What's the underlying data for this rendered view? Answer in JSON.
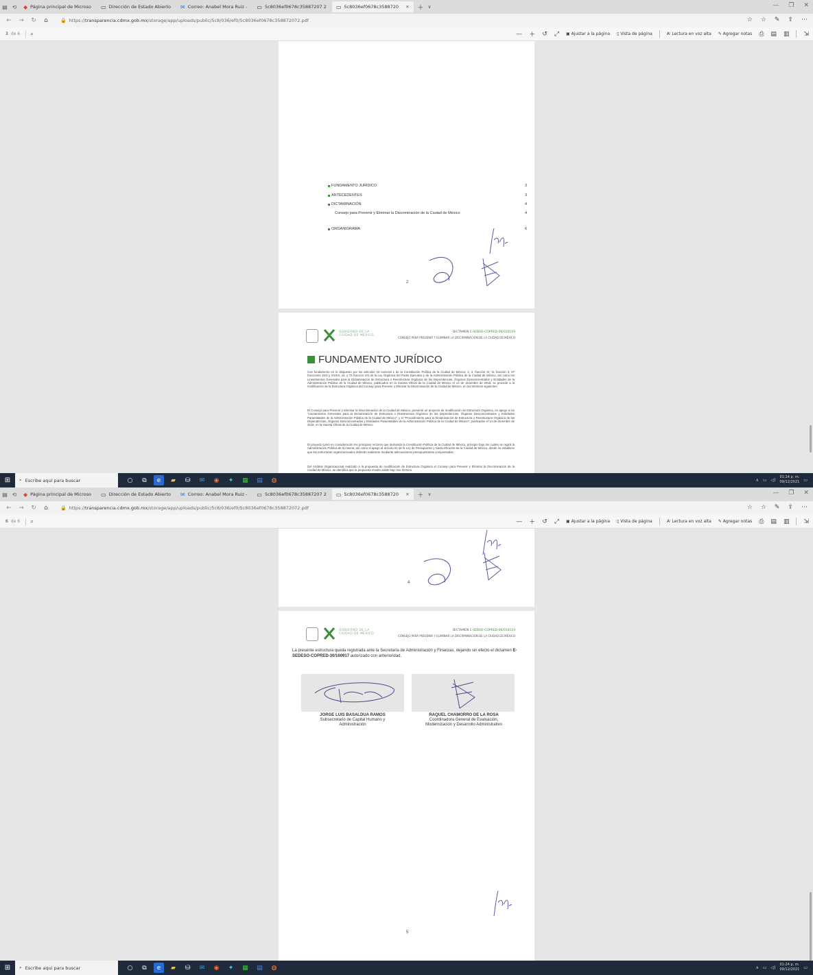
{
  "browser": {
    "tabs": [
      {
        "label": "Página principal de Microso",
        "icon": "microsoft-icon"
      },
      {
        "label": "Dirección de Estado Abierto",
        "icon": "page-icon"
      },
      {
        "label": "Correo: Anabel Mora Ruiz -",
        "icon": "mail-icon"
      },
      {
        "label": "5c8036ef0678c35887207 2",
        "icon": "pdf-icon"
      },
      {
        "label": "5c8036ef0678c3588720",
        "icon": "pdf-icon"
      }
    ],
    "url_prefix": "https://",
    "url_domain": "transparencia.cdmx.gob.mx",
    "url_path": "/storage/app/uploads/public/5c8/036/ef0/5c8036ef0678c358872072.pdf"
  },
  "pdf_toolbar": {
    "of_label": "de 6",
    "fit_label": "Ajustar a la página",
    "view_label": "Vista de página",
    "read_label": "Lectura en voz alta",
    "notes_label": "Agregar notas"
  },
  "shot1": {
    "page_number": "3",
    "toc": [
      {
        "label": "FUNDAMENTO JURÍDICO",
        "page": "3"
      },
      {
        "label": "ANTECEDENTES",
        "page": "3"
      },
      {
        "label": "DICTAMINACIÓN",
        "page": "4"
      },
      {
        "label": "Consejo para Prevenir y Eliminar la Discriminación de la Ciudad de México",
        "page": "4"
      },
      {
        "label": "ORGANIGRAMA",
        "page": "6"
      }
    ],
    "footer_page": "2",
    "section_title": "FUNDAMENTO JURÍDICO",
    "paragraphs": [
      "Con fundamento en lo dispuesto por los artículos 33 numeral 1 de la Constitución Política de la Ciudad de México; 2, 3, fracción XI, 11 fracción II, 27 fracciones XXX y XXXIII, 44, y 73 fracción VIII de la Ley Orgánica del Poder Ejecutivo y de la Administración Pública de la Ciudad de México, así como los Lineamientos Generales para la Dictaminación de Estructura o Reestructura Orgánica de las Dependencias, Órganos Desconcentrados y Entidades de la Administración Pública de la Ciudad de México, publicados en la Gaceta Oficial de la Ciudad de México el 14 de diciembre de 2018, se procede a la modificación de la Estructura Orgánica del Consejo para Prevenir y Eliminar la Discriminación de la Ciudad de México, en los términos siguientes:",
      "El Consejo para Prevenir y Eliminar la Discriminación de la Ciudad de México, presentó un proyecto de modificación de Estructura Orgánica, en apego a los \"Lineamientos Generales para la Dictaminación de Estructura o Reestructura Orgánica de las Dependencias, Órganos Desconcentrados y Entidades Paraestatales de la Administración Pública de la Ciudad de México\"; y el \"Procedimiento para la Dictaminación de Estructura o Reestructura Orgánica de las Dependencias, Órganos Desconcentrados y Entidades Paraestatales de la Administración Pública de la Ciudad de México\"; publicados el 14 de diciembre de 2018, en la Gaceta Oficial de la Ciudad de México.",
      "El proyecto tomó en consideración los principios rectores que demanda la Constitución Política de la Ciudad de México, principio bajo los cuales se regirá la Administración Pública de la misma; así como el apego al artículo 91 de la Ley de Presupuesto y Gasto Eficiente de la Ciudad de México, donde se establece que las estructuras organizacionales deberán realizarse mediante adecuaciones presupuestarias compensadas.",
      "Del Análisis Organizacional realizado a la propuesta de modificación de Estructura Orgánica el Consejo para Prevenir y Eliminar la Discriminación de la Ciudad de México, se identifica que la propuesta resulta viable bajo ese término."
    ]
  },
  "letterhead": {
    "gov1": "GOBIERNO DE LA",
    "gov2": "CIUDAD DE MÉXICO",
    "dict_prefix": "DICTAMEN",
    "dict_code": "E-SEBSO-COPRED-06/010119",
    "council": "CONSEJO PARA PREVENIR Y ELIMINAR LA DISCRIMINACIÓN DE LA CIUDAD DE MÉXICO"
  },
  "shot2": {
    "page_number": "6",
    "footer_page_top": "4",
    "reg_text_1": "La presente estructura queda registrada ante la Secretaría de Administración y Finanzas, dejando sin efecto el dictamen ",
    "reg_code": "E-SEDESO-COPRED-30/160917",
    "reg_text_2": " autorizado con anterioridad.",
    "signers": [
      {
        "name": "JORGE LUIS BASALDUA RAMOS",
        "role1": "Subsecretario de Capital Humano y",
        "role2": "Administración"
      },
      {
        "name": "RAQUEL CHAMORRO DE LA ROSA",
        "role1": "Coordinadora General de Evaluación,",
        "role2": "Modernización y Desarrollo Administrativo"
      }
    ],
    "footer_page": "5"
  },
  "taskbar": {
    "search_placeholder": "Escribe aquí para buscar",
    "time": "01:24 p. m.",
    "date": "09/12/2021"
  }
}
